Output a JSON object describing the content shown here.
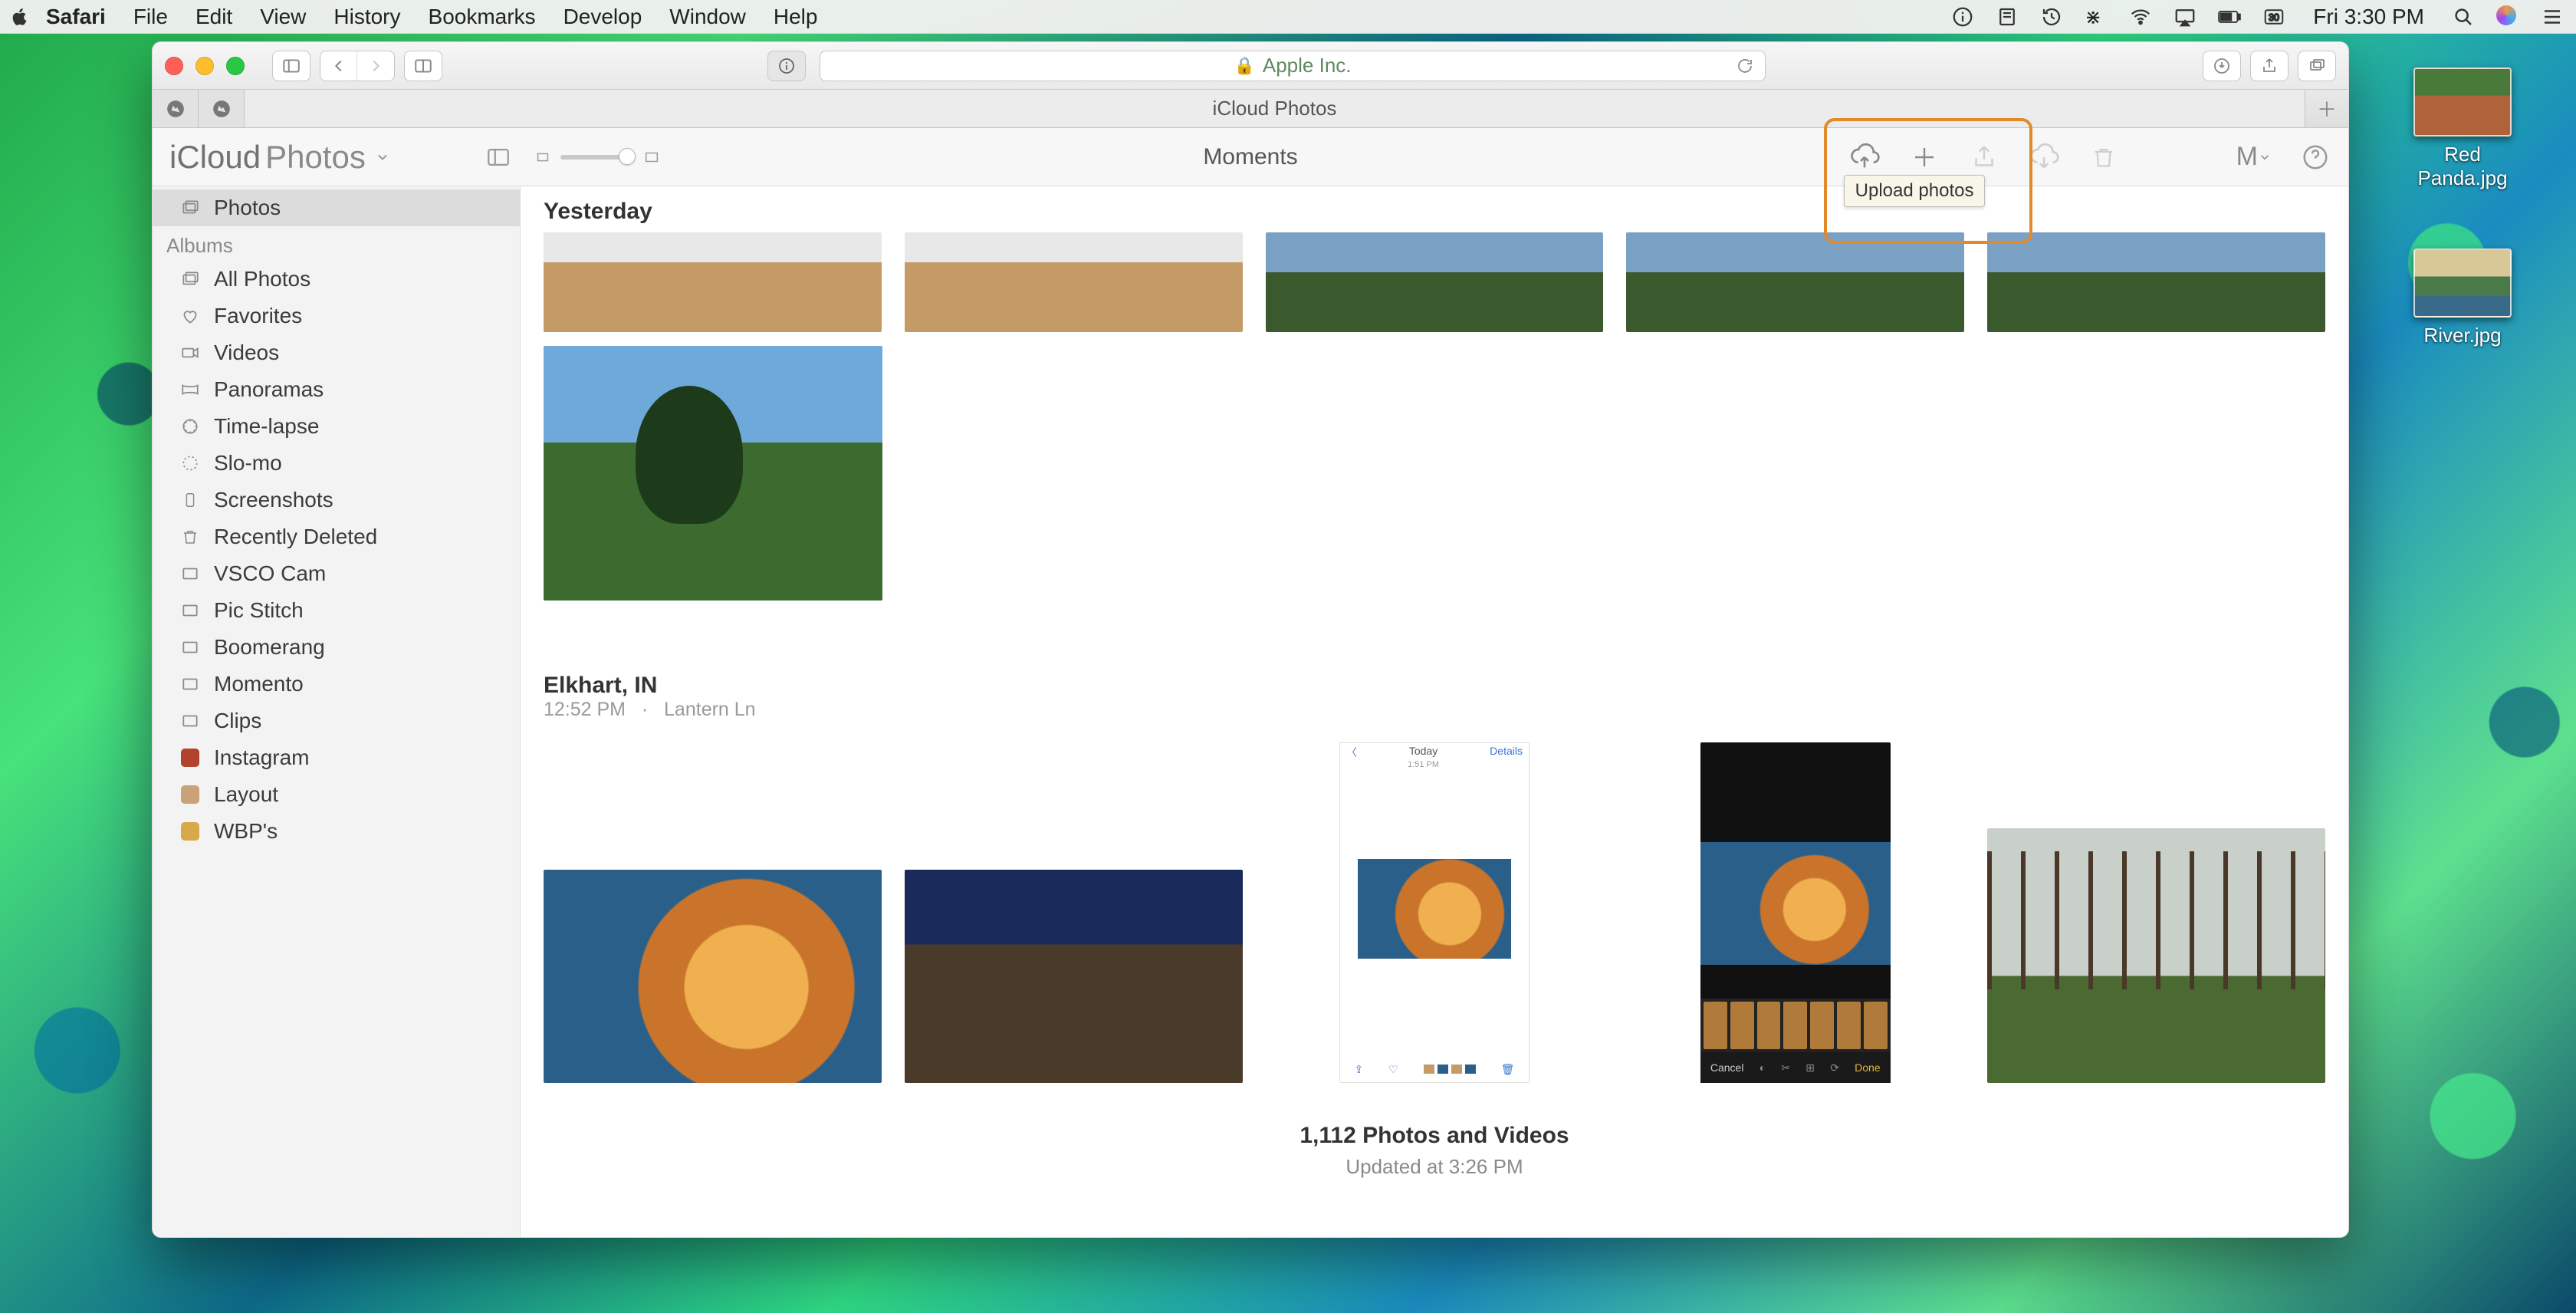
{
  "menubar": {
    "app": "Safari",
    "items": [
      "File",
      "Edit",
      "View",
      "History",
      "Bookmarks",
      "Develop",
      "Window",
      "Help"
    ],
    "clock": "Fri 3:30 PM"
  },
  "safari": {
    "url_host": "Apple Inc.",
    "tab_title": "iCloud Photos"
  },
  "app": {
    "brand_a": "iCloud",
    "brand_b": "Photos",
    "view_title": "Moments",
    "account_initial": "M",
    "tooltip_upload": "Upload photos"
  },
  "sidebar": {
    "top": [
      {
        "icon": "photo",
        "label": "Photos",
        "selected": true
      }
    ],
    "albums_header": "Albums",
    "albums": [
      {
        "icon": "all",
        "label": "All Photos"
      },
      {
        "icon": "heart",
        "label": "Favorites"
      },
      {
        "icon": "video",
        "label": "Videos"
      },
      {
        "icon": "pano",
        "label": "Panoramas"
      },
      {
        "icon": "timelapse",
        "label": "Time-lapse"
      },
      {
        "icon": "slomo",
        "label": "Slo-mo"
      },
      {
        "icon": "device",
        "label": "Screenshots"
      },
      {
        "icon": "trash",
        "label": "Recently Deleted"
      },
      {
        "icon": "album",
        "label": "VSCO Cam"
      },
      {
        "icon": "album",
        "label": "Pic Stitch"
      },
      {
        "icon": "album",
        "label": "Boomerang"
      },
      {
        "icon": "album",
        "label": "Momento"
      },
      {
        "icon": "album",
        "label": "Clips"
      },
      {
        "icon": "swatch",
        "label": "Instagram",
        "swatch": "#b1432e"
      },
      {
        "icon": "swatch",
        "label": "Layout",
        "swatch": "#caa277"
      },
      {
        "icon": "swatch",
        "label": "WBP's",
        "swatch": "#d9a84a"
      }
    ]
  },
  "sections": {
    "yesterday": "Yesterday",
    "elkhart_title": "Elkhart, IN",
    "elkhart_sub_time": "12:52 PM",
    "elkhart_sub_sep": "·",
    "elkhart_sub_loc": "Lantern Ln"
  },
  "screenshot_thumb": {
    "back": "〈",
    "top_center_a": "Today",
    "top_center_b": "1:51 PM",
    "top_right": "Details",
    "cancel": "Cancel",
    "done": "Done"
  },
  "footer": {
    "count": "1,112 Photos and Videos",
    "updated": "Updated at 3:26 PM"
  },
  "desktop": {
    "file1": "Red Panda.jpg",
    "file2": "River.jpg"
  }
}
